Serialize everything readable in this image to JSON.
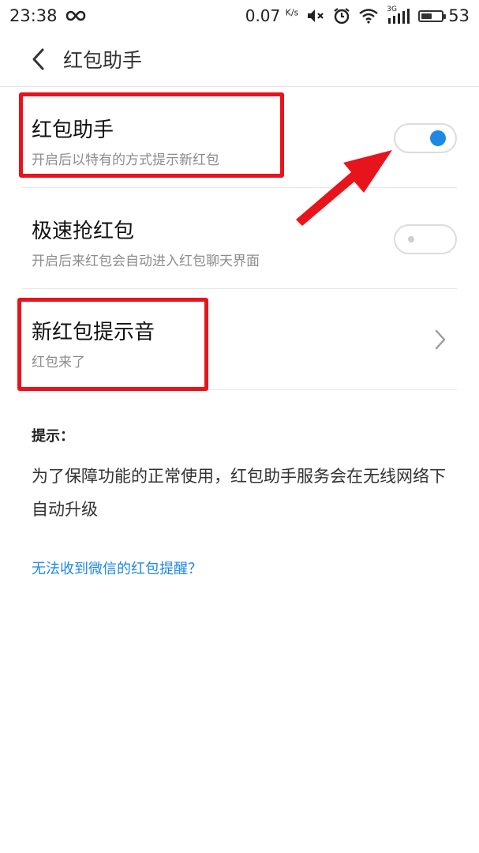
{
  "status_bar": {
    "time": "23:38",
    "infinity_icon": "infinity-icon",
    "speed": "0.07",
    "speed_unit": "K/s",
    "network_label": "3G",
    "battery_level": 53,
    "battery_text": "53"
  },
  "header": {
    "title": "红包助手"
  },
  "settings": {
    "items": [
      {
        "title": "红包助手",
        "subtitle": "开启后以特有的方式提示新红包",
        "toggle_on": true
      },
      {
        "title": "极速抢红包",
        "subtitle": "开启后来红包会自动进入红包聊天界面",
        "toggle_on": false
      },
      {
        "title": "新红包提示音",
        "subtitle": "红包来了"
      }
    ]
  },
  "tips": {
    "label": "提示：",
    "text": "为了保障功能的正常使用，红包助手服务会在无线网络下自动升级"
  },
  "help_link": {
    "label": "无法收到微信的红包提醒？"
  },
  "colors": {
    "accent": "#1e88e5",
    "annotation_red": "#e8141c"
  }
}
